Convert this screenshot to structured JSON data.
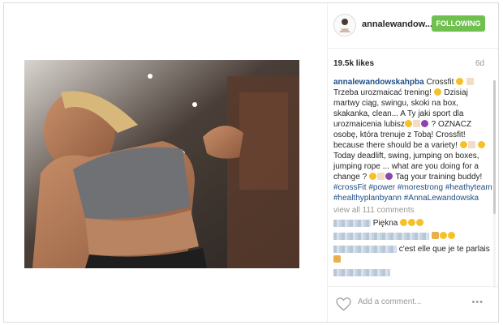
{
  "post": {
    "username": "annalewandow...",
    "follow_label": "FOLLOWING",
    "likes": "19.5k likes",
    "age": "6d",
    "caption": {
      "username": "annalewandowskahpba",
      "text_1": "Crossfit",
      "text_2": "Trzeba urozmaicać trening!",
      "text_3": "Dzisiaj martwy ciąg, swingu, skoki na box, skakanka, clean... A Ty jaki sport dla urozmaicenia lubisz",
      "text_4": "? OZNACZ osobę, która trenuje z Tobą! Crossfit! because there should be a variety!",
      "text_5": "Today deadlift, swing, jumping on boxes, jumping rope ... what are you doing for a change ?",
      "text_6": "Tag your training buddy!",
      "hashtags_1": "#crossFit #power #morestrong",
      "hashtags_2": "#heathyteam #healthyplanbyann",
      "hashtags_3": "#AnnaLewandowska"
    },
    "view_all": "view all 111 comments",
    "comments": [
      {
        "text": "Piękna"
      },
      {
        "text": ""
      },
      {
        "text": "c'est elle que je te parlais"
      },
      {
        "text": ""
      }
    ],
    "add_comment_placeholder": "Add a comment...",
    "more_label": "•••"
  },
  "icons": {
    "avatar": "profile-avatar",
    "heart": "heart-icon",
    "more": "more-options-icon"
  },
  "colors": {
    "follow_button": "#70c050",
    "link_blue": "#1f4f86",
    "muted_gray": "#999999"
  }
}
